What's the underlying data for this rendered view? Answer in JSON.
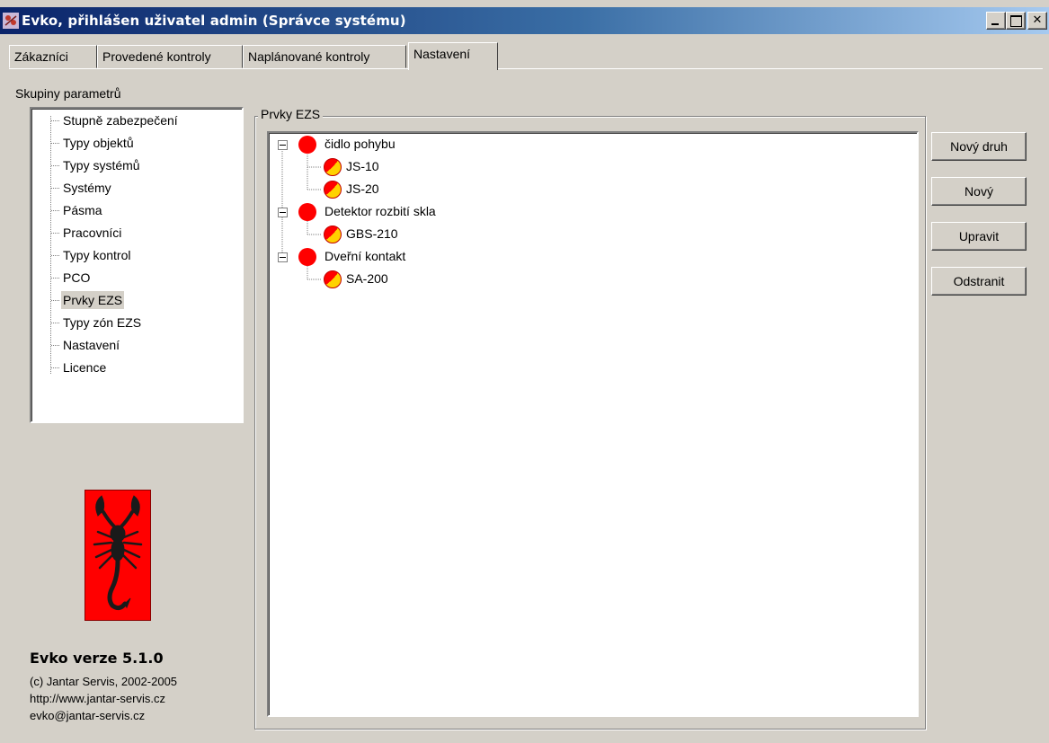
{
  "window": {
    "title": "Evko, přihlášen uživatel admin (Správce systému)"
  },
  "tabs": [
    {
      "label": "Zákazníci",
      "active": false
    },
    {
      "label": "Provedené kontroly",
      "active": false
    },
    {
      "label": "Naplánované kontroly",
      "active": false
    },
    {
      "label": "Nastavení",
      "active": true
    }
  ],
  "parameter_groups": {
    "label": "Skupiny parametrů",
    "items": [
      "Stupně zabezpečení",
      "Typy objektů",
      "Typy systémů",
      "Systémy",
      "Pásma",
      "Pracovníci",
      "Typy kontrol",
      "PCO",
      "Prvky EZS",
      "Typy zón EZS",
      "Nastavení",
      "Licence"
    ],
    "selected": "Prvky EZS"
  },
  "elements": {
    "group_title": "Prvky EZS",
    "tree": [
      {
        "label": "čidlo pohybu",
        "children": [
          "JS-10",
          "JS-20"
        ]
      },
      {
        "label": "Detektor rozbití skla",
        "children": [
          "GBS-210"
        ]
      },
      {
        "label": "Dveřní kontakt",
        "children": [
          "SA-200"
        ]
      }
    ]
  },
  "buttons": {
    "new_type": "Nový druh",
    "new": "Nový",
    "edit": "Upravit",
    "remove": "Odstranit"
  },
  "about": {
    "version": "Evko verze 5.1.0",
    "copyright": "(c) Jantar Servis, 2002-2005",
    "web": "http://www.jantar-servis.cz",
    "email": "evko@jantar-servis.cz"
  },
  "colors": {
    "title_bar_start": "#0a246a",
    "title_bar_end": "#a6caf0",
    "face": "#d4d0c8",
    "node_red": "#ff0000",
    "node_yellow": "#ffd200"
  }
}
